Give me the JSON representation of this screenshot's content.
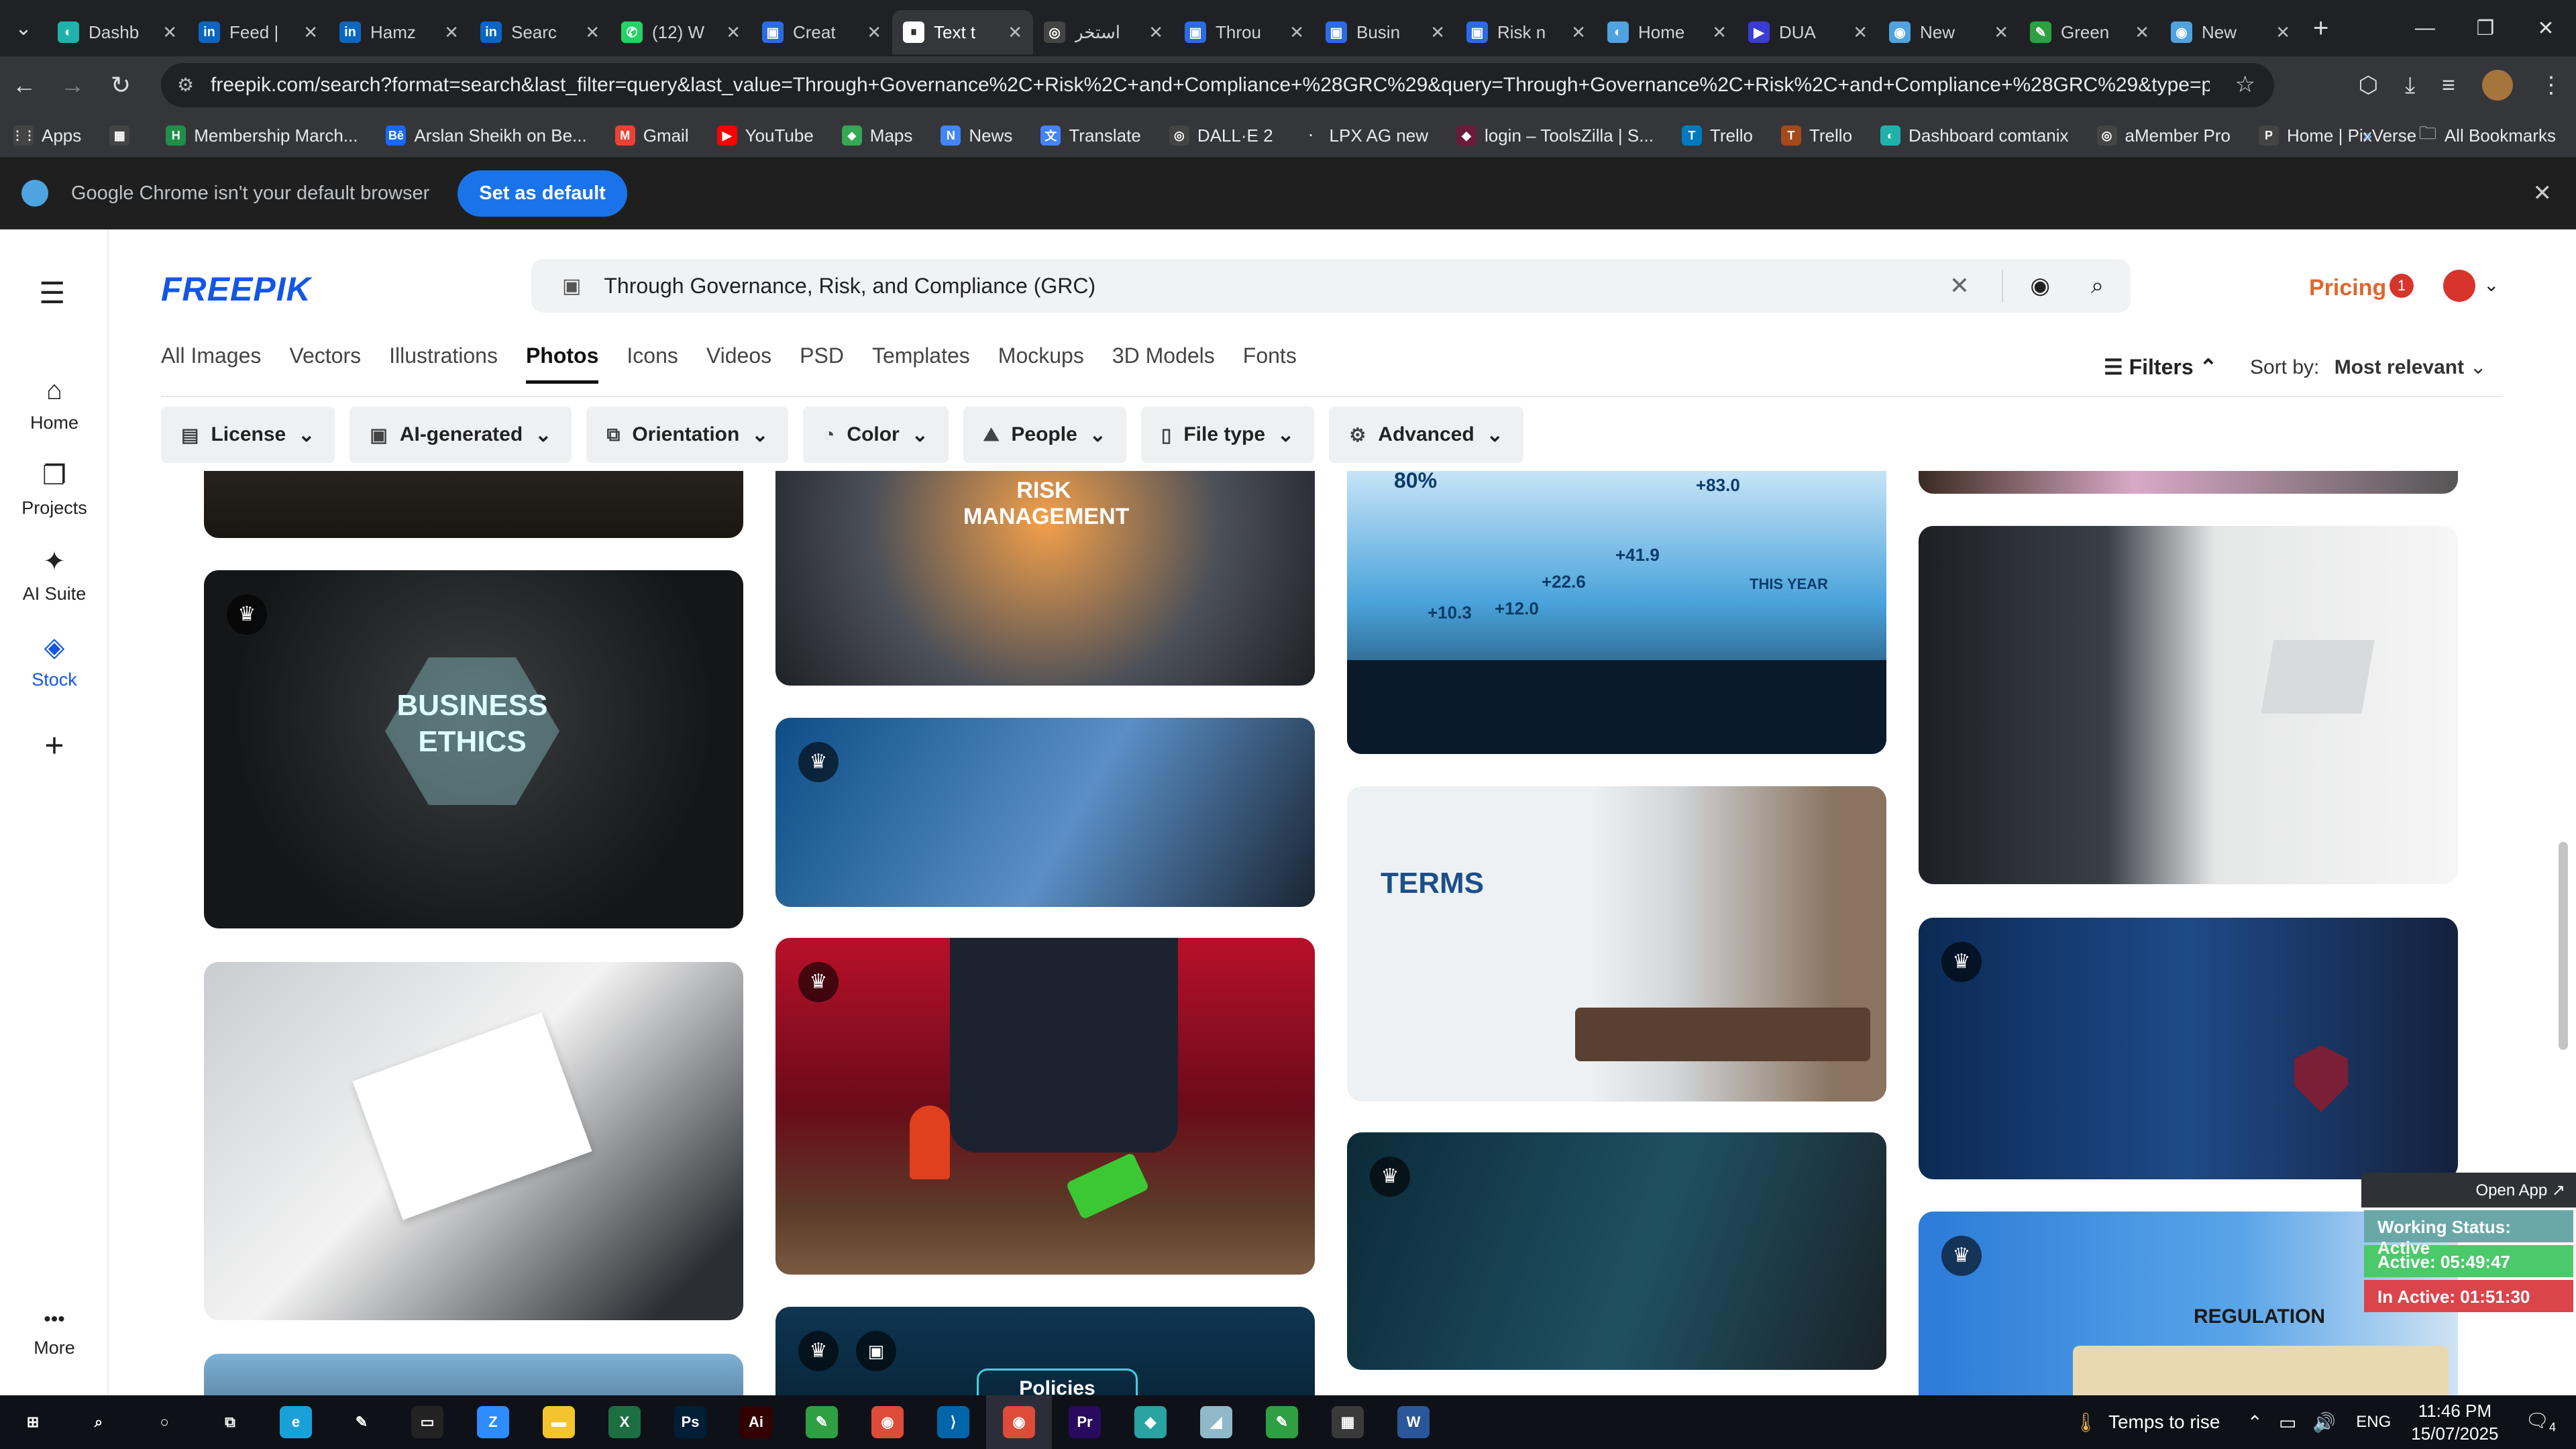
{
  "browser": {
    "tabs": [
      {
        "label": "Dashb",
        "color": "#20b2aa",
        "glyph": "◐"
      },
      {
        "label": "Feed |",
        "color": "#0a66c2",
        "glyph": "in"
      },
      {
        "label": "Hamz",
        "color": "#0a66c2",
        "glyph": "in"
      },
      {
        "label": "Searc",
        "color": "#0a66c2",
        "glyph": "in"
      },
      {
        "label": "(12) W",
        "color": "#25d366",
        "glyph": "✆"
      },
      {
        "label": "Creat",
        "color": "#2b6be6",
        "glyph": "▣"
      },
      {
        "label": "Text t",
        "color": "#ffffff",
        "glyph": "⏸",
        "active": true
      },
      {
        "label": "استخر",
        "color": "#444",
        "glyph": "◎"
      },
      {
        "label": "Throu",
        "color": "#2b6be6",
        "glyph": "▣"
      },
      {
        "label": "Busin",
        "color": "#2b6be6",
        "glyph": "▣"
      },
      {
        "label": "Risk n",
        "color": "#2b6be6",
        "glyph": "▣"
      },
      {
        "label": "Home",
        "color": "#4fa3e0",
        "glyph": "◐"
      },
      {
        "label": "DUA",
        "color": "#3b3bd6",
        "glyph": "▶"
      },
      {
        "label": "New",
        "color": "#4fa3e0",
        "glyph": "◉"
      },
      {
        "label": "Green",
        "color": "#2ea043",
        "glyph": "✎"
      },
      {
        "label": "New",
        "color": "#4fa3e0",
        "glyph": "◉"
      }
    ],
    "url": "freepik.com/search?format=search&last_filter=query&last_value=Through+Governance%2C+Risk%2C+and+Compliance+%28GRC%29&query=Through+Governance%2C+Risk%2C+and+Compliance+%28GRC%29&type=photo",
    "bookmarks": [
      {
        "label": "Apps",
        "color": "#444",
        "glyph": "⋮⋮"
      },
      {
        "label": "",
        "color": "#444",
        "glyph": "▦"
      },
      {
        "label": "Membership March...",
        "color": "#1f8f4a",
        "glyph": "H"
      },
      {
        "label": "Arslan Sheikh on Be...",
        "color": "#1769ff",
        "glyph": "Bē"
      },
      {
        "label": "Gmail",
        "color": "#ea4335",
        "glyph": "M"
      },
      {
        "label": "YouTube",
        "color": "#ff0000",
        "glyph": "▶"
      },
      {
        "label": "Maps",
        "color": "#34a853",
        "glyph": "⬥"
      },
      {
        "label": "News",
        "color": "#4285f4",
        "glyph": "N"
      },
      {
        "label": "Translate",
        "color": "#4285f4",
        "glyph": "文"
      },
      {
        "label": "DALL·E 2",
        "color": "#444",
        "glyph": "◎"
      },
      {
        "label": "LPX AG new",
        "color": "#35363a",
        "glyph": "·"
      },
      {
        "label": "login – ToolsZilla | S...",
        "color": "#6a1b3a",
        "glyph": "◆"
      },
      {
        "label": "Trello",
        "color": "#0079bf",
        "glyph": "T"
      },
      {
        "label": "Trello",
        "color": "#a34a1b",
        "glyph": "T"
      },
      {
        "label": "Dashboard comtanix",
        "color": "#20b2aa",
        "glyph": "◐"
      },
      {
        "label": "aMember Pro",
        "color": "#444",
        "glyph": "◎"
      },
      {
        "label": "Home | PixVerse",
        "color": "#444",
        "glyph": "P"
      }
    ],
    "all_bookmarks": "All Bookmarks",
    "infobar": {
      "message": "Google Chrome isn't your default browser",
      "button": "Set as default"
    }
  },
  "site": {
    "logo": "FREEPIK",
    "sidebar": [
      {
        "label": "Home",
        "icon": "⌂"
      },
      {
        "label": "Projects",
        "icon": "❐"
      },
      {
        "label": "AI Suite",
        "icon": "✦"
      },
      {
        "label": "Stock",
        "icon": "◈",
        "active": true
      },
      {
        "label": "",
        "icon": "+"
      },
      {
        "label": "More",
        "icon": "•••"
      }
    ],
    "search_value": "Through Governance, Risk, and Compliance (GRC)",
    "pricing": "Pricing",
    "notifications": "1",
    "categories": [
      "All Images",
      "Vectors",
      "Illustrations",
      "Photos",
      "Icons",
      "Videos",
      "PSD",
      "Templates",
      "Mockups",
      "3D Models",
      "Fonts"
    ],
    "selected_category": "Photos",
    "filters_label": "Filters",
    "sort_label": "Sort by:",
    "sort_value": "Most relevant",
    "chips": [
      {
        "label": "License",
        "icon": "▤"
      },
      {
        "label": "AI-generated",
        "icon": "▣"
      },
      {
        "label": "Orientation",
        "icon": "⧉"
      },
      {
        "label": "Color",
        "icon": "◔"
      },
      {
        "label": "People",
        "icon": "⛰"
      },
      {
        "label": "File type",
        "icon": "▯"
      },
      {
        "label": "Advanced",
        "icon": "⚙"
      }
    ],
    "image_labels": {
      "business_ethics": "BUSINESS ETHICS",
      "risk_management": "RISK MANAGEMENT",
      "terms": "TERMS",
      "regulation": "REGULATION",
      "policies": "Policies",
      "stats": [
        "80%",
        "+83.0",
        "+41.9",
        "+22.6",
        "+10.3",
        "+12.0",
        "THIS YEAR"
      ]
    }
  },
  "widget": {
    "open_app": "Open App ↗",
    "status": "Working Status: Active",
    "active": "Active: 05:49:47",
    "inactive": "In Active: 01:51:30",
    "colors": {
      "status": "#6aa8a8",
      "active": "#4cc96b",
      "inactive": "#d9454b"
    }
  },
  "taskbar": {
    "weather": "Temps to rise",
    "lang": "ENG",
    "time": "11:46 PM",
    "date": "15/07/2025",
    "notif_count": "4",
    "apps": [
      {
        "name": "start",
        "color": "#0f1118",
        "glyph": "⊞"
      },
      {
        "name": "search",
        "color": "#0f1118",
        "glyph": "⌕"
      },
      {
        "name": "cortana",
        "color": "#0f1118",
        "glyph": "○"
      },
      {
        "name": "task-view",
        "color": "#0f1118",
        "glyph": "⧉"
      },
      {
        "name": "edge",
        "color": "#1aa0d8",
        "glyph": "e"
      },
      {
        "name": "pen",
        "color": "#0f1118",
        "glyph": "✎"
      },
      {
        "name": "terminal",
        "color": "#222",
        "glyph": "▭"
      },
      {
        "name": "zoom",
        "color": "#2d8cff",
        "glyph": "Z"
      },
      {
        "name": "explorer",
        "color": "#f4c430",
        "glyph": "▬"
      },
      {
        "name": "excel",
        "color": "#1d6f42",
        "glyph": "X"
      },
      {
        "name": "photoshop",
        "color": "#001e36",
        "glyph": "Ps"
      },
      {
        "name": "illustrator",
        "color": "#330000",
        "glyph": "Ai"
      },
      {
        "name": "app-green",
        "color": "#2ea043",
        "glyph": "✎"
      },
      {
        "name": "chrome",
        "color": "#dd4b39",
        "glyph": "◉"
      },
      {
        "name": "vscode",
        "color": "#0065a9",
        "glyph": "⟩"
      },
      {
        "name": "chrome-active",
        "color": "#dd4b39",
        "glyph": "◉"
      },
      {
        "name": "premiere",
        "color": "#2a0a5e",
        "glyph": "Pr"
      },
      {
        "name": "app-teal",
        "color": "#2aa3a3",
        "glyph": "◆"
      },
      {
        "name": "app-glass",
        "color": "#8fb8c8",
        "glyph": "◢"
      },
      {
        "name": "app-green2",
        "color": "#2ea043",
        "glyph": "✎"
      },
      {
        "name": "calculator",
        "color": "#3a3a3a",
        "glyph": "▦"
      },
      {
        "name": "word",
        "color": "#2b579a",
        "glyph": "W"
      }
    ]
  }
}
